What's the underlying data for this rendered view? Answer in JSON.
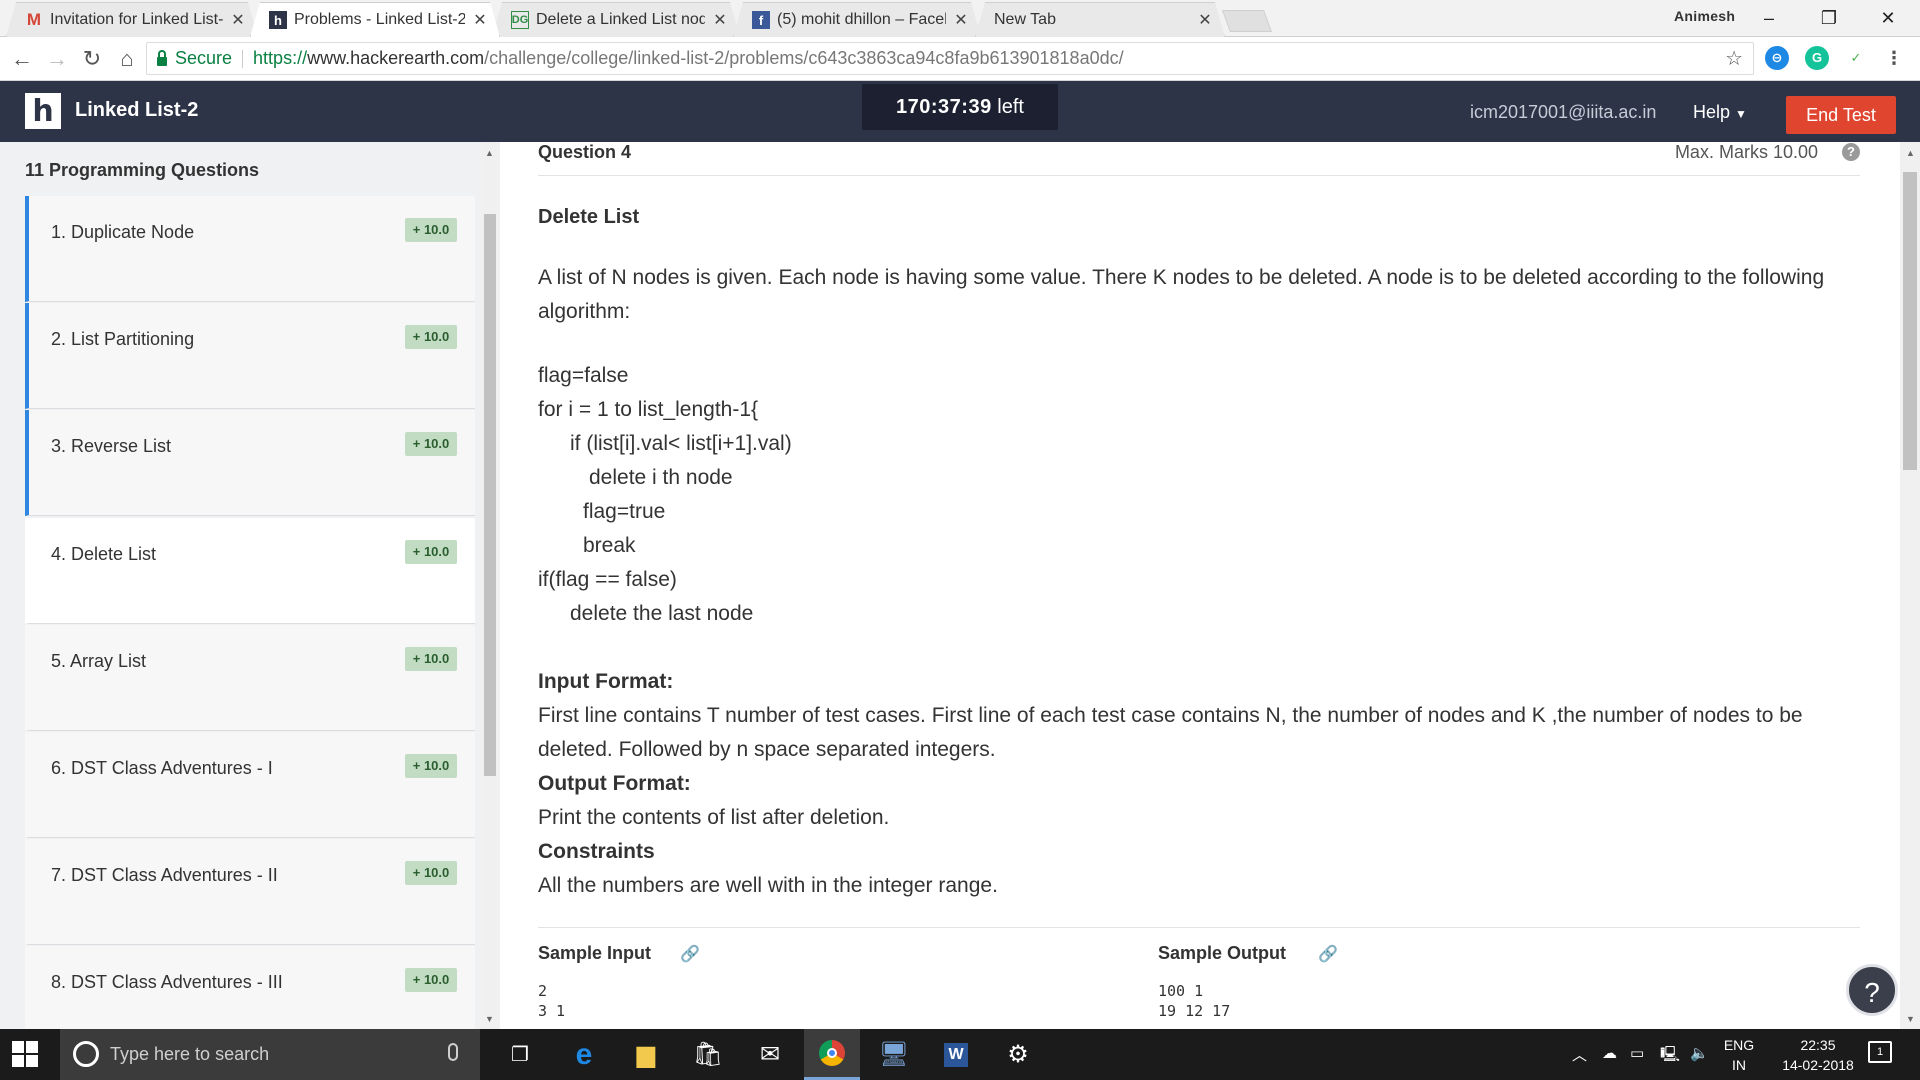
{
  "browser": {
    "tabs": [
      {
        "icon": "gmail-icon",
        "title": "Invitation for Linked List-"
      },
      {
        "icon": "hackerearth-icon",
        "title": "Problems - Linked List-2"
      },
      {
        "icon": "gfg-icon",
        "title": "Delete a Linked List node"
      },
      {
        "icon": "facebook-icon",
        "title": "(5) mohit dhillon – Faceb"
      },
      {
        "icon": "",
        "title": "New Tab"
      }
    ],
    "profile_name": "Animesh",
    "secure_label": "Secure",
    "url_proto": "https://",
    "url_host": "www.hackerearth.com",
    "url_path": "/challenge/college/linked-list-2/problems/c643c3863ca94c8fa9b613901818a0dc/"
  },
  "header": {
    "logo_letter": "h",
    "title": "Linked List-2",
    "timer": "170:37:39",
    "timer_suffix": "left",
    "email": "icm2017001@iiita.ac.in",
    "help_label": "Help",
    "end_test_label": "End Test"
  },
  "sidebar": {
    "title": "11 Programming Questions",
    "items": [
      {
        "label": "1. Duplicate Node",
        "badge": "+ 10.0"
      },
      {
        "label": "2. List Partitioning",
        "badge": "+ 10.0"
      },
      {
        "label": "3. Reverse List",
        "badge": "+ 10.0"
      },
      {
        "label": "4. Delete List",
        "badge": "+ 10.0"
      },
      {
        "label": "5. Array List",
        "badge": "+ 10.0"
      },
      {
        "label": "6. DST Class Adventures - I",
        "badge": "+ 10.0"
      },
      {
        "label": "7. DST Class Adventures - II",
        "badge": "+ 10.0"
      },
      {
        "label": "8. DST Class Adventures - III",
        "badge": "+ 10.0"
      }
    ]
  },
  "question": {
    "number_label": "Question  4",
    "max_marks": "Max. Marks 10.00",
    "title": "Delete List",
    "intro": "A list of N nodes is given. Each node is having some value. There K nodes to be deleted. A node is to be deleted according to the following algorithm:",
    "algo": [
      "flag=false",
      "for i = 1 to list_length-1{",
      "if (list[i].val< list[i+1].val)",
      "delete i th node",
      "flag=true",
      "break",
      "if(flag == false)",
      "delete the last node"
    ],
    "input_format_label": "Input Format:",
    "input_format": "First line contains T number of test cases. First line of each test case contains N, the number of nodes and K ,the number of nodes to be deleted. Followed by n space separated integers.",
    "output_format_label": "Output Format:",
    "output_format": "Print the contents of list after deletion.",
    "constraints_label": "Constraints",
    "constraints": "All the numbers are well with in the integer range.",
    "sample_input_label": "Sample Input",
    "sample_output_label": "Sample Output",
    "sample_input": "2\n3 1",
    "sample_output": "100 1\n19 12 17"
  },
  "taskbar": {
    "search_placeholder": "Type here to search",
    "lang_top": "ENG",
    "lang_bottom": "IN",
    "time": "22:35",
    "date": "14-02-2018",
    "notif_count": "1"
  }
}
